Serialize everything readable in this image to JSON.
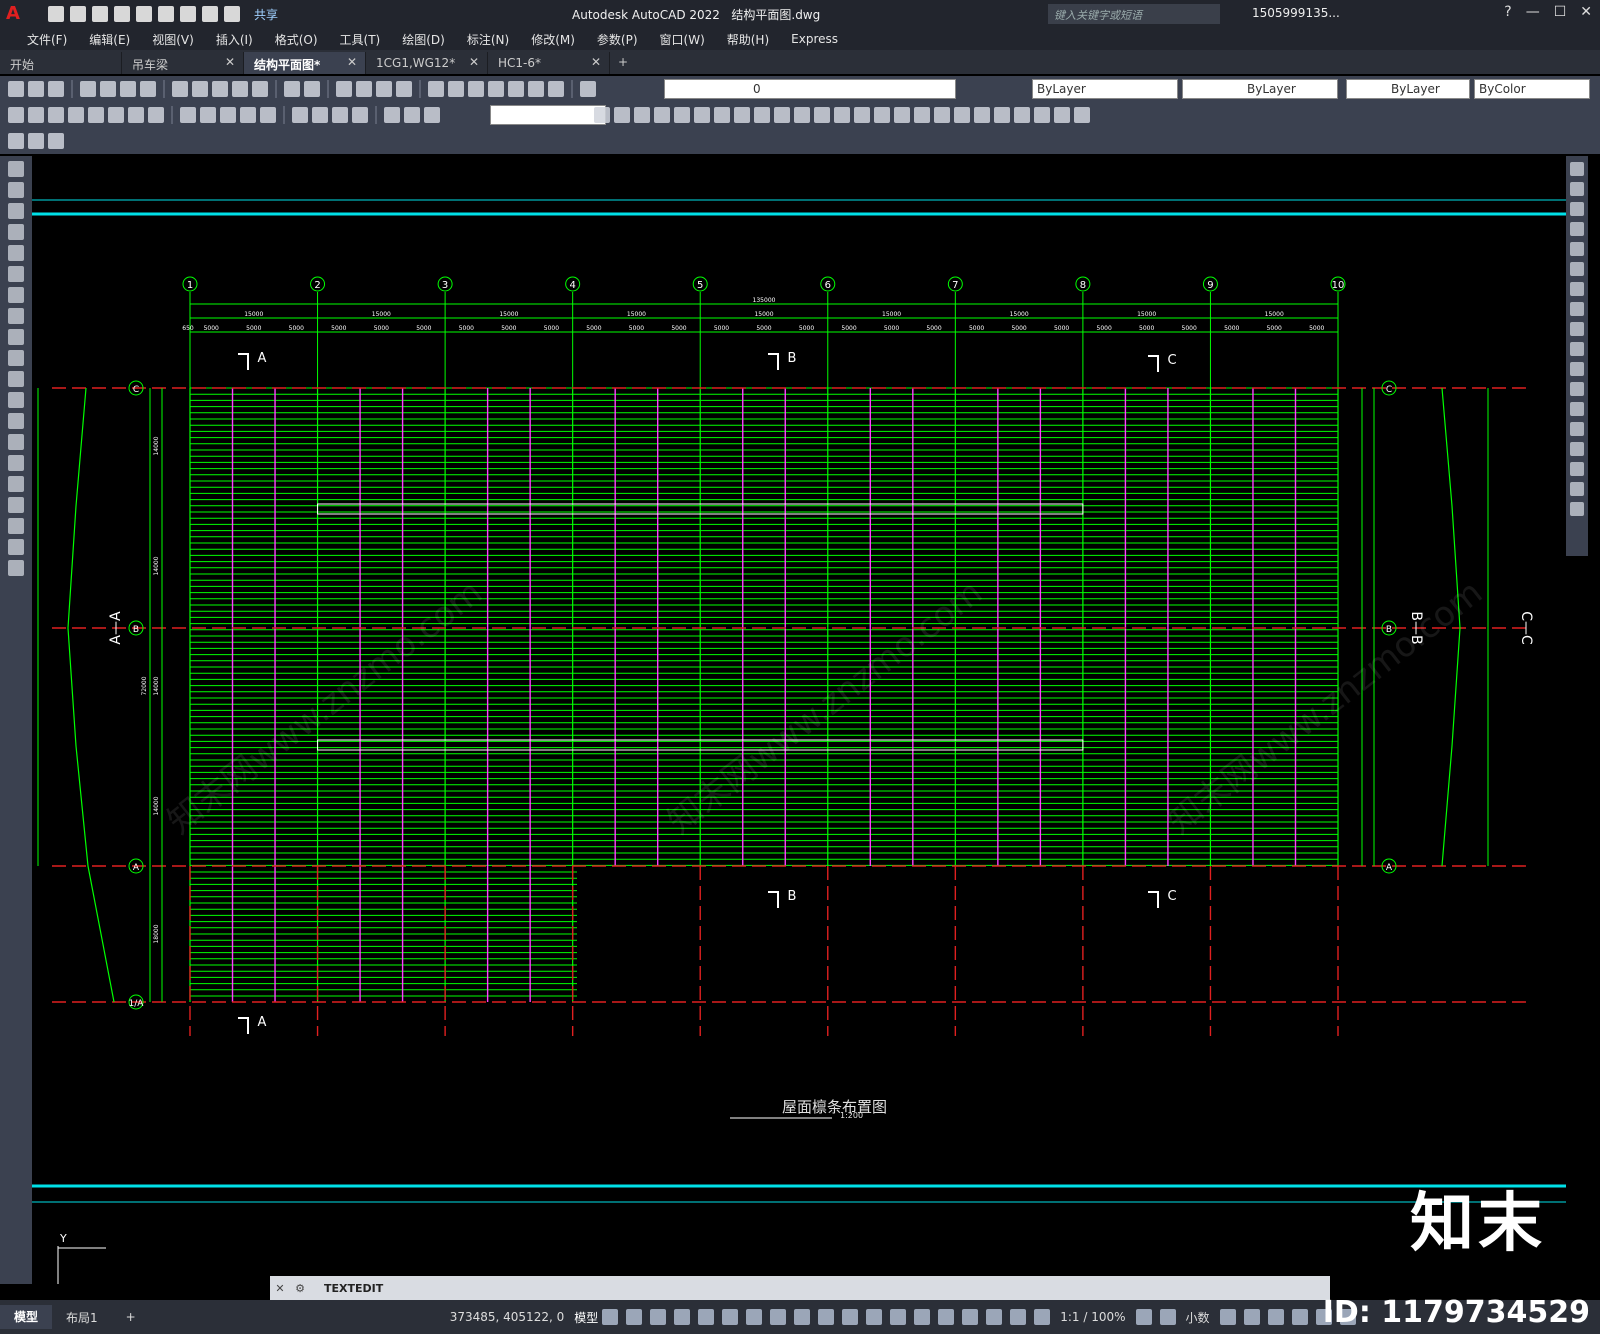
{
  "app": {
    "title": "Autodesk AutoCAD 2022",
    "file": "结构平面图.dwg",
    "logo": "A",
    "share": "共享",
    "search_placeholder": "键入关键字或短语",
    "user": "1505999135...",
    "help": "?"
  },
  "menu": [
    "文件(F)",
    "编辑(E)",
    "视图(V)",
    "插入(I)",
    "格式(O)",
    "工具(T)",
    "绘图(D)",
    "标注(N)",
    "修改(M)",
    "参数(P)",
    "窗口(W)",
    "帮助(H)",
    "Express"
  ],
  "tabs": [
    {
      "label": "开始",
      "active": false,
      "closable": false
    },
    {
      "label": "吊车梁",
      "active": false,
      "closable": true
    },
    {
      "label": "结构平面图*",
      "active": true,
      "closable": true
    },
    {
      "label": "1CG1,WG12*",
      "active": false,
      "closable": true
    },
    {
      "label": "HC1-6*",
      "active": false,
      "closable": true
    }
  ],
  "properties": {
    "layer": "0",
    "color": "ByLayer",
    "linetype": "ByLayer",
    "lineweight": "ByLayer",
    "plotstyle": "ByColor"
  },
  "drawing": {
    "grid_columns": [
      "1",
      "2",
      "3",
      "4",
      "5",
      "6",
      "7",
      "8",
      "9",
      "10"
    ],
    "grid_rows": [
      "C",
      "B",
      "A",
      "1/A"
    ],
    "overall_dim": "135000",
    "bay_dim": "15000",
    "sub_dim": "5000",
    "edge_dim": "650",
    "section_labels": [
      "A",
      "B",
      "C"
    ],
    "section_titles": [
      "A—A",
      "B—B",
      "C—C"
    ],
    "row_dims": [
      "14000",
      "14000",
      "14000",
      "14000",
      "18000",
      "72000"
    ],
    "plan_title": "屋面檩条布置图",
    "plan_scale": "1:200"
  },
  "command": {
    "text": "TEXTEDIT"
  },
  "status": {
    "layout_tabs": [
      "模型",
      "布局1"
    ],
    "coords": "373485, 405122, 0",
    "mode": "模型",
    "scale": "1:1 / 100%",
    "units": "小数"
  },
  "watermark": {
    "logo": "知末",
    "id": "ID: 1179734529",
    "text": "知末网www.znzmo.com"
  },
  "colors": {
    "accent": "#00ff00",
    "magenta": "#ff40ff",
    "red": "#e02020",
    "cyan": "#00e0e8",
    "white": "#ffffff"
  }
}
